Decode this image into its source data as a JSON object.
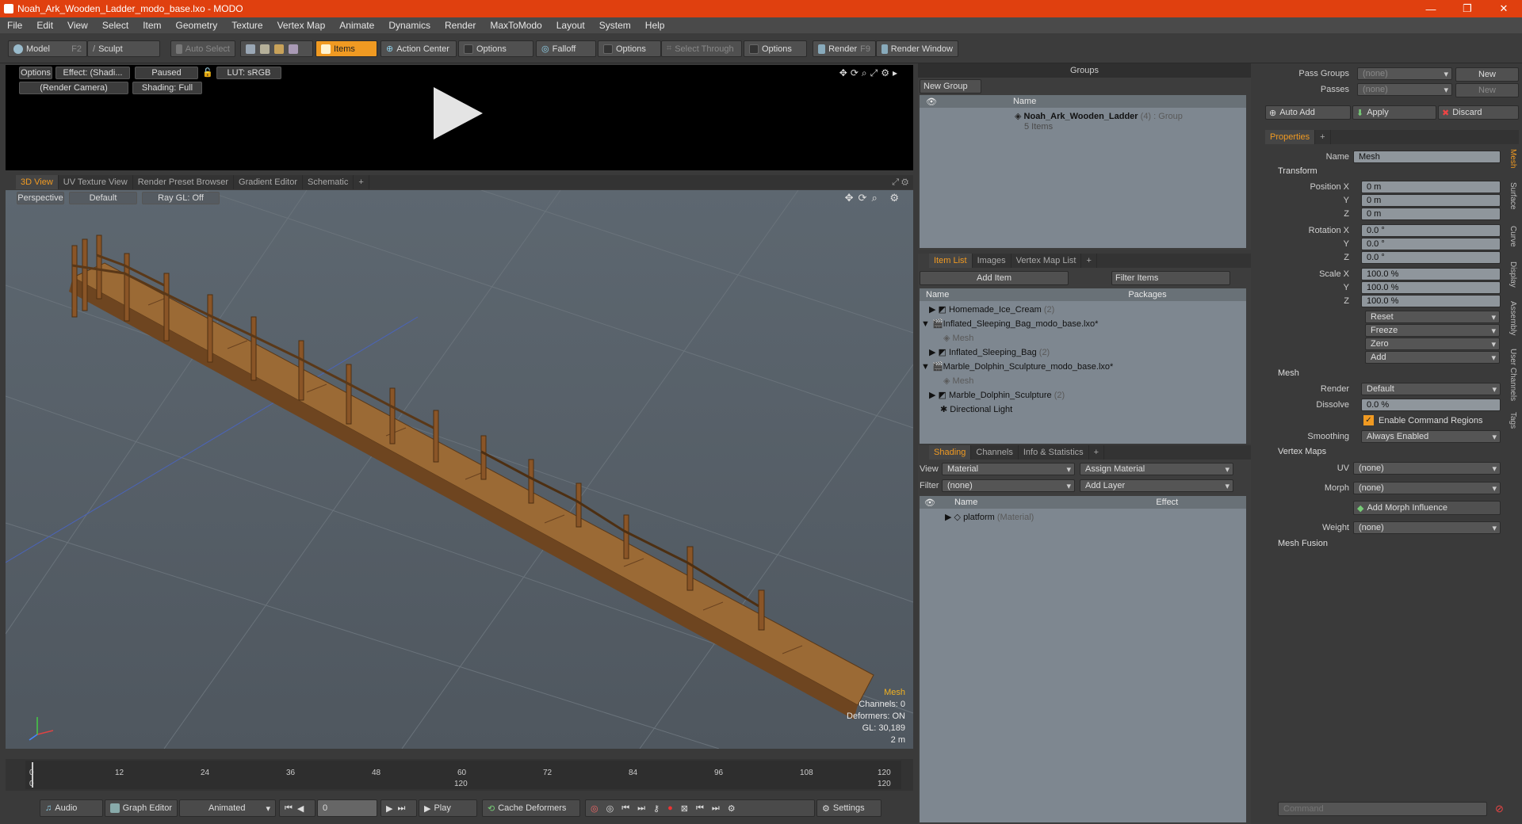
{
  "window": {
    "title": "Noah_Ark_Wooden_Ladder_modo_base.lxo - MODO",
    "minimize": "—",
    "maximize": "❐",
    "close": "✕"
  },
  "menu": [
    "File",
    "Edit",
    "View",
    "Select",
    "Item",
    "Geometry",
    "Texture",
    "Vertex Map",
    "Animate",
    "Dynamics",
    "Render",
    "MaxToModo",
    "Layout",
    "System",
    "Help"
  ],
  "toolbar": {
    "model": "Model",
    "model_key": "F2",
    "sculpt": "Sculpt",
    "auto_select": "Auto Select",
    "items": "Items",
    "action_center": "Action Center",
    "options1": "Options",
    "falloff": "Falloff",
    "options2": "Options",
    "select_through": "Select Through",
    "options3": "Options",
    "render": "Render",
    "render_key": "F9",
    "render_window": "Render Window"
  },
  "preview": {
    "options": "Options",
    "effect": "Effect: (Shadi...",
    "paused": "Paused",
    "lut": "LUT: sRGB",
    "camera": "(Render Camera)",
    "shading": "Shading: Full"
  },
  "view_tabs": [
    "3D View",
    "UV Texture View",
    "Render Preset Browser",
    "Gradient Editor",
    "Schematic",
    "+"
  ],
  "viewport": {
    "projection": "Perspective",
    "style": "Default",
    "raygl": "Ray GL: Off",
    "hud": {
      "type": "Mesh",
      "channels": "Channels: 0",
      "deformers": "Deformers: ON",
      "gl": "GL: 30,189",
      "scale": "2 m"
    }
  },
  "timeline": {
    "ticks": [
      "0",
      "12",
      "24",
      "36",
      "48",
      "60",
      "72",
      "84",
      "96",
      "108",
      "120"
    ],
    "sub_ticks": [
      "0",
      "120",
      "120"
    ]
  },
  "transport": {
    "audio": "Audio",
    "graph_editor": "Graph Editor",
    "animated": "Animated",
    "frame": "0",
    "play": "Play",
    "cache": "Cache Deformers",
    "settings": "Settings"
  },
  "groups": {
    "title": "Groups",
    "new_group": "New Group",
    "name_col": "Name",
    "item_name": "Noah_Ark_Wooden_Ladder",
    "item_count": "(4)",
    "item_type": ": Group",
    "item_sub": "5 Items"
  },
  "itemlist": {
    "tabs": [
      "Item List",
      "Images",
      "Vertex Map List",
      "+"
    ],
    "add_item": "Add Item",
    "filter": "Filter Items",
    "col_name": "Name",
    "col_packages": "Packages",
    "rows": [
      {
        "label": "Homemade_Ice_Cream",
        "extra": "(2)"
      },
      {
        "label": "Inflated_Sleeping_Bag_modo_base.lxo*",
        "extra": ""
      },
      {
        "label": "Mesh",
        "extra": ""
      },
      {
        "label": "Inflated_Sleeping_Bag",
        "extra": "(2)"
      },
      {
        "label": "Marble_Dolphin_Sculpture_modo_base.lxo*",
        "extra": ""
      },
      {
        "label": "Mesh",
        "extra": ""
      },
      {
        "label": "Marble_Dolphin_Sculpture",
        "extra": "(2)"
      },
      {
        "label": "Directional Light",
        "extra": ""
      }
    ]
  },
  "shading": {
    "tabs": [
      "Shading",
      "Channels",
      "Info & Statistics",
      "+"
    ],
    "view_label": "View",
    "view_value": "Material",
    "assign": "Assign Material",
    "filter_label": "Filter",
    "filter_value": "(none)",
    "add_layer": "Add Layer",
    "col_name": "Name",
    "col_effect": "Effect",
    "row_name": "platform",
    "row_type": "(Material)"
  },
  "passes": {
    "pass_groups": "Pass Groups",
    "pass_groups_val": "(none)",
    "new1": "New",
    "passes": "Passes",
    "passes_val": "(none)",
    "new2": "New",
    "auto_add": "Auto Add",
    "apply": "Apply",
    "discard": "Discard"
  },
  "properties": {
    "tab": "Properties",
    "plus": "+",
    "name_label": "Name",
    "name_value": "Mesh",
    "transform": "Transform",
    "position_x_label": "Position X",
    "pos": [
      "0 m",
      "0 m",
      "0 m"
    ],
    "rotation_x_label": "Rotation X",
    "rot": [
      "0.0 °",
      "0.0 °",
      "0.0 °"
    ],
    "scale_x_label": "Scale X",
    "scl": [
      "100.0 %",
      "100.0 %",
      "100.0 %"
    ],
    "y": "Y",
    "z": "Z",
    "reset": "Reset",
    "freeze": "Freeze",
    "zero": "Zero",
    "add": "Add",
    "mesh": "Mesh",
    "render_label": "Render",
    "render_value": "Default",
    "dissolve_label": "Dissolve",
    "dissolve_value": "0.0 %",
    "enable_cmd": "Enable Command Regions",
    "smoothing_label": "Smoothing",
    "smoothing_value": "Always Enabled",
    "vertex_maps": "Vertex Maps",
    "uv_label": "UV",
    "uv_value": "(none)",
    "morph_label": "Morph",
    "morph_value": "(none)",
    "add_morph": "Add Morph Influence",
    "weight_label": "Weight",
    "weight_value": "(none)",
    "mesh_fusion": "Mesh Fusion",
    "side_tabs": [
      "Mesh",
      "Surface",
      "Curve",
      "Display",
      "Assembly",
      "User Channels",
      "Tags"
    ]
  },
  "command": {
    "placeholder": "Command"
  },
  "colors": {
    "accent": "#f09a22",
    "titlebar": "#e0400f",
    "wood": "#8a5a2b"
  }
}
